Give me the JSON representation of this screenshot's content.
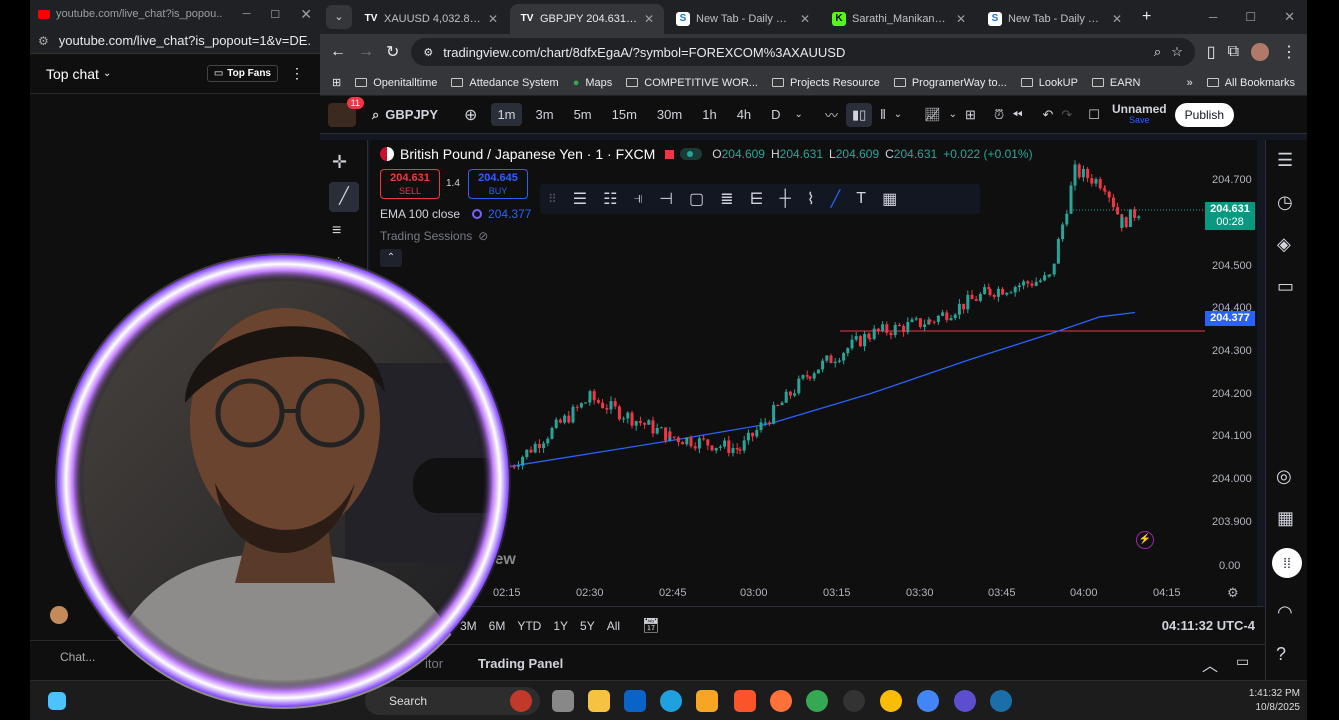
{
  "popout": {
    "window_title": "youtube.com/live_chat?is_popou...",
    "url": "youtube.com/live_chat?is_popout=1&v=DE...",
    "chat_mode": "Top chat",
    "top_fans": "Top Fans",
    "chat_placeholder": "Chat..."
  },
  "browser": {
    "tabs": [
      {
        "label": "XAUUSD 4,032.87 ▲",
        "icon": "tv-icon"
      },
      {
        "label": "GBPJPY 204.631 ▲ +0",
        "icon": "tv-icon"
      },
      {
        "label": "New Tab - Daily Moti",
        "icon": "s-icon"
      },
      {
        "label": "Sarathi_Manikandan",
        "icon": "kick-icon"
      },
      {
        "label": "New Tab - Daily Moti",
        "icon": "s-icon"
      }
    ],
    "url": "tradingview.com/chart/8dfxEgaA/?symbol=FOREXCOM%3AXAUUSD",
    "bookmarks": [
      "Openitalltime",
      "Attedance System",
      "Maps",
      "COMPETITIVE WOR...",
      "Projects Resource",
      "ProgramerWay to...",
      "LookUP",
      "EARN"
    ],
    "all_bookmarks": "All Bookmarks"
  },
  "tv": {
    "notif_count": "11",
    "symbol": "GBPJPY",
    "intervals": [
      "1m",
      "3m",
      "5m",
      "15m",
      "30m",
      "1h",
      "4h",
      "D"
    ],
    "selected_interval": "1m",
    "layout_name": "Unnamed",
    "layout_status": "Save",
    "publish": "Publish",
    "legend": {
      "title": "British Pound / Japanese Yen · 1 · FXCM",
      "o_label": "O",
      "o": "204.609",
      "h_label": "H",
      "h": "204.631",
      "l_label": "L",
      "l": "204.609",
      "c_label": "C",
      "c": "204.631",
      "change": "+0.022 (+0.01%)"
    },
    "sell_price": "204.631",
    "sell_label": "SELL",
    "spread": "1.4",
    "buy_price": "204.645",
    "buy_label": "BUY",
    "ema_label": "EMA 100 close",
    "ema_value": "204.377",
    "sessions_label": "Trading Sessions",
    "price_axis": [
      "204.700",
      "204.500",
      "204.400",
      "204.300",
      "204.200",
      "204.100",
      "204.000",
      "203.900",
      "0.00"
    ],
    "last_price": "204.631",
    "countdown": "00:28",
    "ema_tag": "204.377",
    "time_axis": [
      "02:15",
      "02:30",
      "02:45",
      "03:00",
      "03:15",
      "03:30",
      "03:45",
      "04:00",
      "04:15"
    ],
    "watermark": "iew",
    "ranges": [
      "3M",
      "6M",
      "YTD",
      "1Y",
      "5Y",
      "All"
    ],
    "clock": "04:11:32 UTC-4",
    "panel_left": "itor",
    "panel_trading": "Trading Panel",
    "colors": {
      "up": "#26a69a",
      "down": "#f23645",
      "ema": "#2962ff",
      "bg": "#0f0f0f"
    }
  },
  "taskbar": {
    "search": "Search",
    "time": "1:41:32 PM",
    "date": "10/8/2025"
  }
}
